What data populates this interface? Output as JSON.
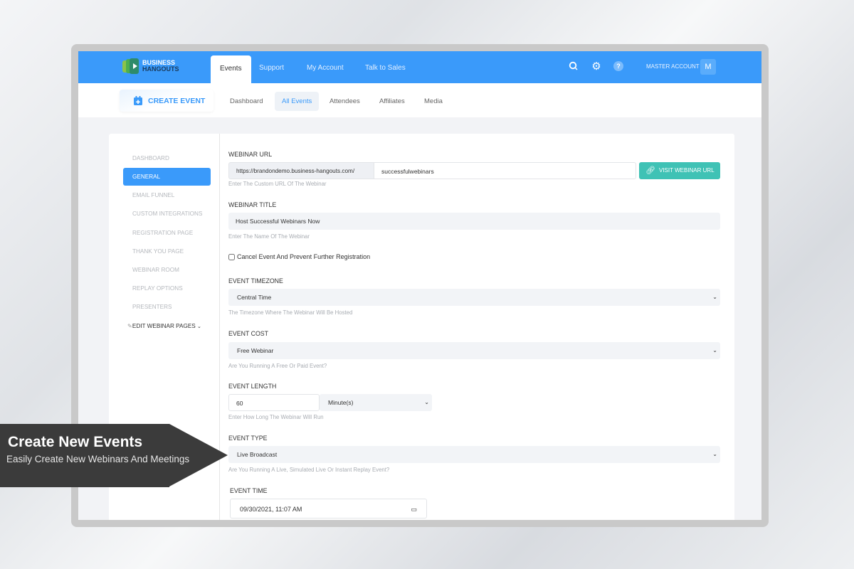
{
  "brand": {
    "line1": "BUSINESS",
    "line2": "HANGOUTS"
  },
  "topnav": {
    "tabs": [
      {
        "label": "Events",
        "active": true
      },
      {
        "label": "Support"
      },
      {
        "label": "My Account"
      },
      {
        "label": "Talk to Sales"
      }
    ],
    "icons": [
      "search-icon",
      "gear-icon",
      "help-icon"
    ],
    "account_label": "MASTER ACCOUNT",
    "avatar": "M"
  },
  "subnav": {
    "create_label": "CREATE EVENT",
    "tabs": [
      {
        "label": "Dashboard"
      },
      {
        "label": "All Events",
        "active": true
      },
      {
        "label": "Attendees"
      },
      {
        "label": "Affiliates"
      },
      {
        "label": "Media"
      }
    ]
  },
  "sidebar": {
    "items": [
      {
        "label": "DASHBOARD"
      },
      {
        "label": "GENERAL",
        "active": true
      },
      {
        "label": "EMAIL FUNNEL"
      },
      {
        "label": "CUSTOM INTEGRATIONS"
      },
      {
        "label": "REGISTRATION PAGE"
      },
      {
        "label": "THANK YOU PAGE"
      },
      {
        "label": "WEBINAR ROOM"
      },
      {
        "label": "REPLAY OPTIONS"
      },
      {
        "label": "PRESENTERS"
      }
    ],
    "edit_pages": "EDIT WEBINAR PAGES"
  },
  "form": {
    "webinar_url": {
      "label": "WEBINAR URL",
      "prefix": "https://brandondemo.business-hangouts.com/",
      "value": "successfulwebinars",
      "hint": "Enter The Custom URL Of The Webinar",
      "button": "VISIT WEBINAR URL"
    },
    "webinar_title": {
      "label": "WEBINAR TITLE",
      "value": "Host Successful Webinars Now",
      "hint": "Enter The Name Of The Webinar"
    },
    "cancel_event": {
      "label": "Cancel Event And Prevent Further Registration",
      "checked": false
    },
    "timezone": {
      "label": "EVENT TIMEZONE",
      "value": "Central Time",
      "hint": "The Timezone Where The Webinar Will Be Hosted"
    },
    "cost": {
      "label": "EVENT COST",
      "value": "Free Webinar",
      "hint": "Are You Running A Free Or Paid Event?"
    },
    "length": {
      "label": "EVENT LENGTH",
      "value": "60",
      "unit": "Minute(s)",
      "hint": "Enter How Long The Webinar Will Run"
    },
    "type": {
      "label": "EVENT TYPE",
      "value": "Live Broadcast",
      "hint": "Are You Running A Live, Simulated Live Or Instant Replay Event?"
    },
    "time": {
      "label": "EVENT TIME",
      "value": "09/30/2021, 11:07 AM"
    }
  },
  "banner": {
    "title": "Create New Events",
    "subtitle": "Easily Create New Webinars And Meetings"
  },
  "colors": {
    "primary": "#3a9afa",
    "teal": "#3fc2b5",
    "banner": "#3b3b3b"
  }
}
